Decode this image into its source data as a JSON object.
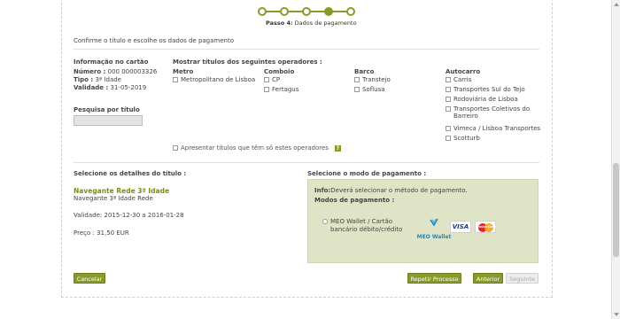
{
  "stepper": {
    "steps_total": 5,
    "current_step": 4,
    "label_bold": "Passo 4:",
    "label_text": " Dados de pagamento"
  },
  "intro": "Confirme o título e escolhe os dados de pagamento",
  "card": {
    "title": "Informação no cartão",
    "numero_label": "Número :",
    "numero_value": " 000 000003326",
    "tipo_label": "Tipo :",
    "tipo_value": " 3ª Idade",
    "validade_label": "Validade :",
    "validade_value": " 31-05-2019"
  },
  "search": {
    "title": "Pesquisa por título",
    "value": ""
  },
  "operators": {
    "title": "Mostrar títulos dos seguintes operadores :",
    "columns": [
      {
        "title": "Metro",
        "items": [
          "Metropolitano de Lisboa"
        ]
      },
      {
        "title": "Comboio",
        "items": [
          "CP",
          "Fertagus"
        ]
      },
      {
        "title": "Barco",
        "items": [
          "Transtejo",
          "Soflusa"
        ]
      },
      {
        "title": "Autocarro",
        "items": [
          "Carris",
          "Transportes Sul do Tejo",
          "Rodoviária de Lisboa",
          "Transportes Coletivos do Barreiro",
          "Vimeca / Lisboa Transportes",
          "Scotturb"
        ]
      }
    ],
    "only_these": "Apresentar títulos que têm só estes operadores",
    "help": "?"
  },
  "details": {
    "title": "Selecione os detalhes do título :",
    "product_name": "Navegante Rede 3ª Idade",
    "product_sub": "Navegante 3ª Idade Rede",
    "validity": "Validade: 2015-12-30 a 2016-01-28",
    "price": "Preço : 31,50 EUR"
  },
  "payment": {
    "title": "Selecione o modo de pagamento :",
    "info_label": "Info:",
    "info_text": "Deverá selecionar o método de pagamento.",
    "modes_label": "Modos de pagamento :",
    "option_line1": "MEO Wallet / Cartão",
    "option_line2": "bancário débito/crédito",
    "meo_label": "MEO Wallet",
    "visa_label": "VISA",
    "mastercard_label": "MasterCard"
  },
  "buttons": {
    "cancel": "Cancelar",
    "repeat": "Repetir Processo",
    "previous": "Anterior",
    "next": "Seguinte"
  },
  "colors": {
    "accent": "#8a9a2a",
    "panel": "#dfe4c7",
    "product": "#7a8c16"
  }
}
